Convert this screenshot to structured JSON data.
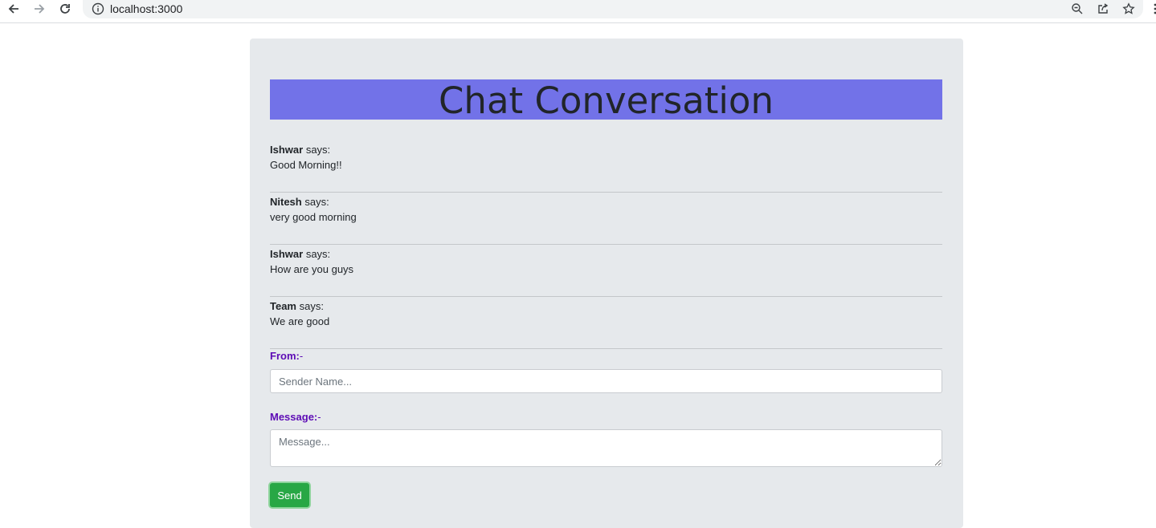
{
  "browser": {
    "url": "localhost:3000",
    "icons": [
      "back-arrow-icon",
      "forward-arrow-icon",
      "reload-icon",
      "site-info-icon",
      "zoom-icon",
      "share-icon",
      "bookmark-star-icon"
    ]
  },
  "page": {
    "title": "Chat Conversation",
    "says_label": "says:",
    "messages": [
      {
        "sender": "Ishwar",
        "text": "Good Morning!!"
      },
      {
        "sender": "Nitesh",
        "text": "very good morning"
      },
      {
        "sender": "Ishwar",
        "text": "How are you guys"
      },
      {
        "sender": "Team",
        "text": "We are good"
      }
    ],
    "form": {
      "from_label": "From:",
      "from_suffix": "-",
      "sender_placeholder": "Sender Name...",
      "sender_value": "",
      "message_label": "Message:",
      "message_suffix": "-",
      "message_placeholder": "Message...",
      "message_value": "",
      "send_label": "Send"
    }
  },
  "colors": {
    "card_background": "#e6e9ec",
    "title_banner": "#7272e8",
    "label_purple": "#5d0bb5",
    "send_button": "#28a745"
  }
}
